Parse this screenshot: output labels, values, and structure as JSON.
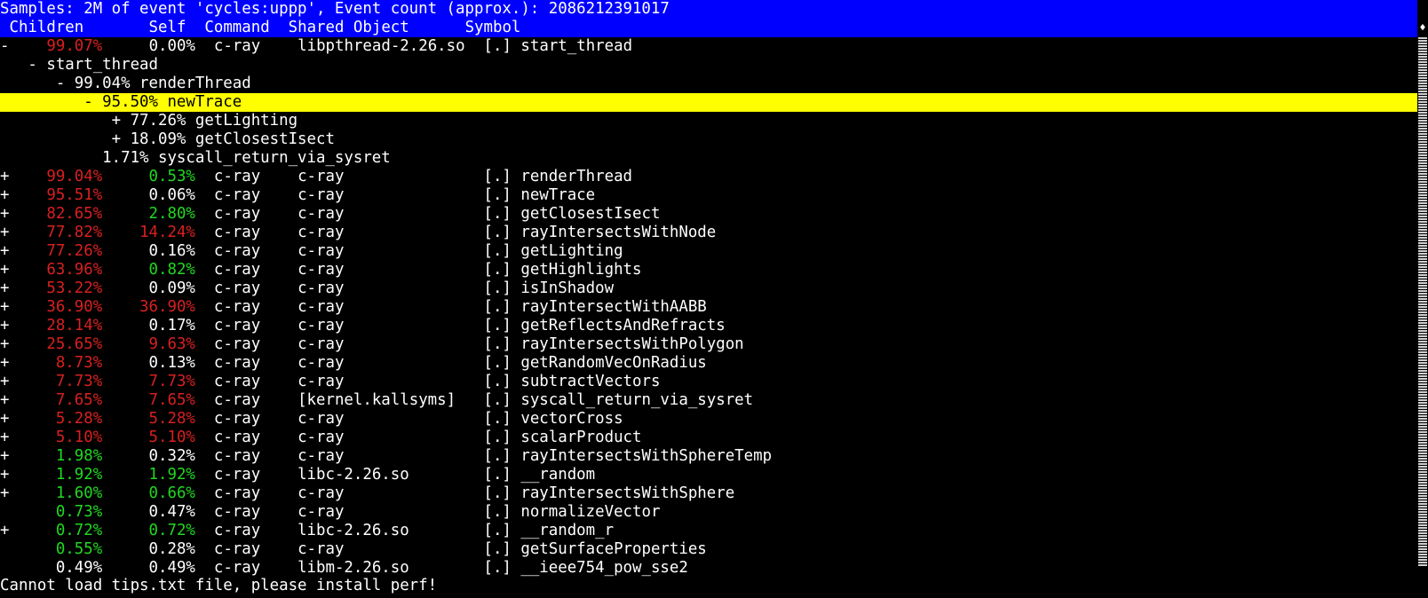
{
  "header": {
    "samples_line": "Samples: 2M of event 'cycles:uppp', Event count (approx.): 2086212391017",
    "columns": [
      " Children",
      "     Self",
      "Command",
      "Shared Object",
      "Symbol"
    ]
  },
  "colors": {
    "header_bg": "#0000ff",
    "highlight_bg": "#ffff00",
    "red": "#d82020",
    "green": "#20d820"
  },
  "first_row": {
    "fold": "-",
    "children": "99.07%",
    "self": "0.00%",
    "command": "c-ray",
    "dso": "libpthread-2.26.so",
    "symbol": "[.] start_thread"
  },
  "tree": [
    {
      "text": "   - start_thread"
    },
    {
      "text": "      - 99.04% renderThread"
    },
    {
      "text": "         - 95.50% newTrace",
      "selected": true
    },
    {
      "text": "            + 77.26% getLighting"
    },
    {
      "text": "            + 18.09% getClosestIsect"
    },
    {
      "text": "           1.71% syscall_return_via_sysret"
    }
  ],
  "rows": [
    {
      "fold": "+",
      "children": "99.04%",
      "children_color": "red",
      "self": "0.53%",
      "self_color": "green",
      "command": "c-ray",
      "dso": "c-ray",
      "symbol": "[.] renderThread"
    },
    {
      "fold": "+",
      "children": "95.51%",
      "children_color": "red",
      "self": "0.06%",
      "self_color": "white",
      "command": "c-ray",
      "dso": "c-ray",
      "symbol": "[.] newTrace"
    },
    {
      "fold": "+",
      "children": "82.65%",
      "children_color": "red",
      "self": "2.80%",
      "self_color": "green",
      "command": "c-ray",
      "dso": "c-ray",
      "symbol": "[.] getClosestIsect"
    },
    {
      "fold": "+",
      "children": "77.82%",
      "children_color": "red",
      "self": "14.24%",
      "self_color": "red",
      "command": "c-ray",
      "dso": "c-ray",
      "symbol": "[.] rayIntersectsWithNode"
    },
    {
      "fold": "+",
      "children": "77.26%",
      "children_color": "red",
      "self": "0.16%",
      "self_color": "white",
      "command": "c-ray",
      "dso": "c-ray",
      "symbol": "[.] getLighting"
    },
    {
      "fold": "+",
      "children": "63.96%",
      "children_color": "red",
      "self": "0.82%",
      "self_color": "green",
      "command": "c-ray",
      "dso": "c-ray",
      "symbol": "[.] getHighlights"
    },
    {
      "fold": "+",
      "children": "53.22%",
      "children_color": "red",
      "self": "0.09%",
      "self_color": "white",
      "command": "c-ray",
      "dso": "c-ray",
      "symbol": "[.] isInShadow"
    },
    {
      "fold": "+",
      "children": "36.90%",
      "children_color": "red",
      "self": "36.90%",
      "self_color": "red",
      "command": "c-ray",
      "dso": "c-ray",
      "symbol": "[.] rayIntersectWithAABB"
    },
    {
      "fold": "+",
      "children": "28.14%",
      "children_color": "red",
      "self": "0.17%",
      "self_color": "white",
      "command": "c-ray",
      "dso": "c-ray",
      "symbol": "[.] getReflectsAndRefracts"
    },
    {
      "fold": "+",
      "children": "25.65%",
      "children_color": "red",
      "self": "9.63%",
      "self_color": "red",
      "command": "c-ray",
      "dso": "c-ray",
      "symbol": "[.] rayIntersectsWithPolygon"
    },
    {
      "fold": "+",
      "children": "8.73%",
      "children_color": "red",
      "self": "0.13%",
      "self_color": "white",
      "command": "c-ray",
      "dso": "c-ray",
      "symbol": "[.] getRandomVecOnRadius"
    },
    {
      "fold": "+",
      "children": "7.73%",
      "children_color": "red",
      "self": "7.73%",
      "self_color": "red",
      "command": "c-ray",
      "dso": "c-ray",
      "symbol": "[.] subtractVectors"
    },
    {
      "fold": "+",
      "children": "7.65%",
      "children_color": "red",
      "self": "7.65%",
      "self_color": "red",
      "command": "c-ray",
      "dso": "[kernel.kallsyms]",
      "symbol": "[.] syscall_return_via_sysret"
    },
    {
      "fold": "+",
      "children": "5.28%",
      "children_color": "red",
      "self": "5.28%",
      "self_color": "red",
      "command": "c-ray",
      "dso": "c-ray",
      "symbol": "[.] vectorCross"
    },
    {
      "fold": "+",
      "children": "5.10%",
      "children_color": "red",
      "self": "5.10%",
      "self_color": "red",
      "command": "c-ray",
      "dso": "c-ray",
      "symbol": "[.] scalarProduct"
    },
    {
      "fold": "+",
      "children": "1.98%",
      "children_color": "green",
      "self": "0.32%",
      "self_color": "white",
      "command": "c-ray",
      "dso": "c-ray",
      "symbol": "[.] rayIntersectsWithSphereTemp"
    },
    {
      "fold": "+",
      "children": "1.92%",
      "children_color": "green",
      "self": "1.92%",
      "self_color": "green",
      "command": "c-ray",
      "dso": "libc-2.26.so",
      "symbol": "[.] __random"
    },
    {
      "fold": "+",
      "children": "1.60%",
      "children_color": "green",
      "self": "0.66%",
      "self_color": "green",
      "command": "c-ray",
      "dso": "c-ray",
      "symbol": "[.] rayIntersectsWithSphere"
    },
    {
      "fold": " ",
      "children": "0.73%",
      "children_color": "green",
      "self": "0.47%",
      "self_color": "white",
      "command": "c-ray",
      "dso": "c-ray",
      "symbol": "[.] normalizeVector"
    },
    {
      "fold": "+",
      "children": "0.72%",
      "children_color": "green",
      "self": "0.72%",
      "self_color": "green",
      "command": "c-ray",
      "dso": "libc-2.26.so",
      "symbol": "[.] __random_r"
    },
    {
      "fold": " ",
      "children": "0.55%",
      "children_color": "green",
      "self": "0.28%",
      "self_color": "white",
      "command": "c-ray",
      "dso": "c-ray",
      "symbol": "[.] getSurfaceProperties"
    },
    {
      "fold": " ",
      "children": "0.49%",
      "children_color": "white",
      "self": "0.49%",
      "self_color": "white",
      "command": "c-ray",
      "dso": "libm-2.26.so",
      "symbol": "[.] __ieee754_pow_sse2"
    }
  ],
  "scrollbar": {
    "arrow_icon": "up-down-arrow-icon",
    "arrow_glyph": "♦"
  },
  "status": {
    "message": "Cannot load tips.txt file, please install perf!"
  }
}
